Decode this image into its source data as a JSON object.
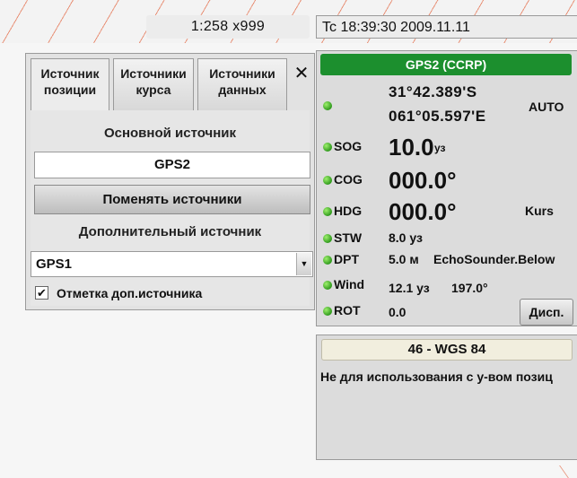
{
  "top_bar": {
    "scale": "1:258 x999",
    "time": "Tc 18:39:30 2009.11.11"
  },
  "sources_panel": {
    "tabs": [
      {
        "line1": "Источник",
        "line2": "позиции"
      },
      {
        "line1": "Источники",
        "line2": "курса"
      },
      {
        "line1": "Источники",
        "line2": "данных"
      }
    ],
    "close": "✕",
    "main_caption": "Основной источник",
    "main_value": "GPS2",
    "change_button": "Поменять источники",
    "extra_caption": "Дополнительный источник",
    "extra_value": "GPS1",
    "select_arrow": "▼",
    "mark_checked": "✔",
    "mark_label": "Отметка доп.источника"
  },
  "nav_panel": {
    "header": "GPS2 (CCRP)",
    "latitude": "31°42.389'S",
    "longitude": "061°05.597'E",
    "mode": "AUTO",
    "sog": {
      "label": "SOG",
      "value": "10.0",
      "unit": "уз"
    },
    "cog": {
      "label": "COG",
      "value": "000.0°"
    },
    "hdg": {
      "label": "HDG",
      "value": "000.0°",
      "source": "Kurs"
    },
    "stw": {
      "label": "STW",
      "value": "8.0 уз"
    },
    "dpt": {
      "label": "DPT",
      "value": "5.0 м",
      "source": "EchoSounder.Below"
    },
    "wind": {
      "label": "Wind",
      "speed": "12.1 уз",
      "direction": "197.0°"
    },
    "rot": {
      "label": "ROT",
      "value": "0.0"
    },
    "disp_button": "Дисп."
  },
  "datum_panel": {
    "title": "46 - WGS 84",
    "warning": "Не для использования с у-вом позиц"
  },
  "colors": {
    "status_green": "#1c8f2e",
    "indicator_green": "#3fb21f",
    "hatch": "#e8937a"
  }
}
